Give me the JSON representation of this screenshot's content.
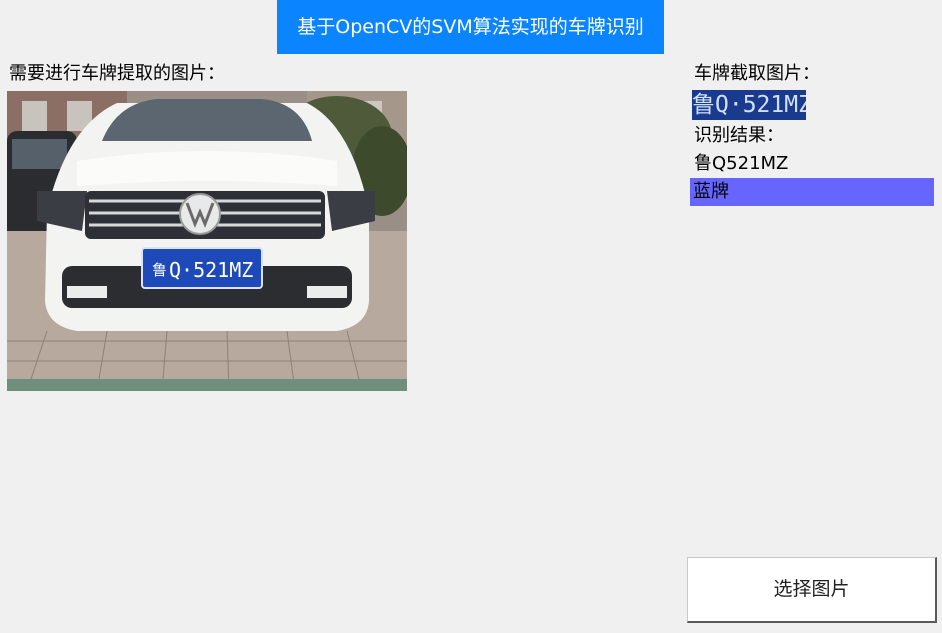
{
  "title": "基于OpenCV的SVM算法实现的车牌识别",
  "left_panel": {
    "label": "需要进行车牌提取的图片：",
    "image_plate_text_cn": "鲁",
    "image_plate_text": "Q·521MZ"
  },
  "right_panel": {
    "crop_label": "车牌截取图片：",
    "crop_plate_text": "鲁Q·521MZ",
    "result_label": "识别结果：",
    "result_value": "鲁Q521MZ",
    "color_value": "蓝牌"
  },
  "button": {
    "label": "选择图片"
  },
  "colors": {
    "title_bg": "#0a84ff",
    "plate_color_bg": "#6666ff",
    "background": "#f0f0f0"
  }
}
